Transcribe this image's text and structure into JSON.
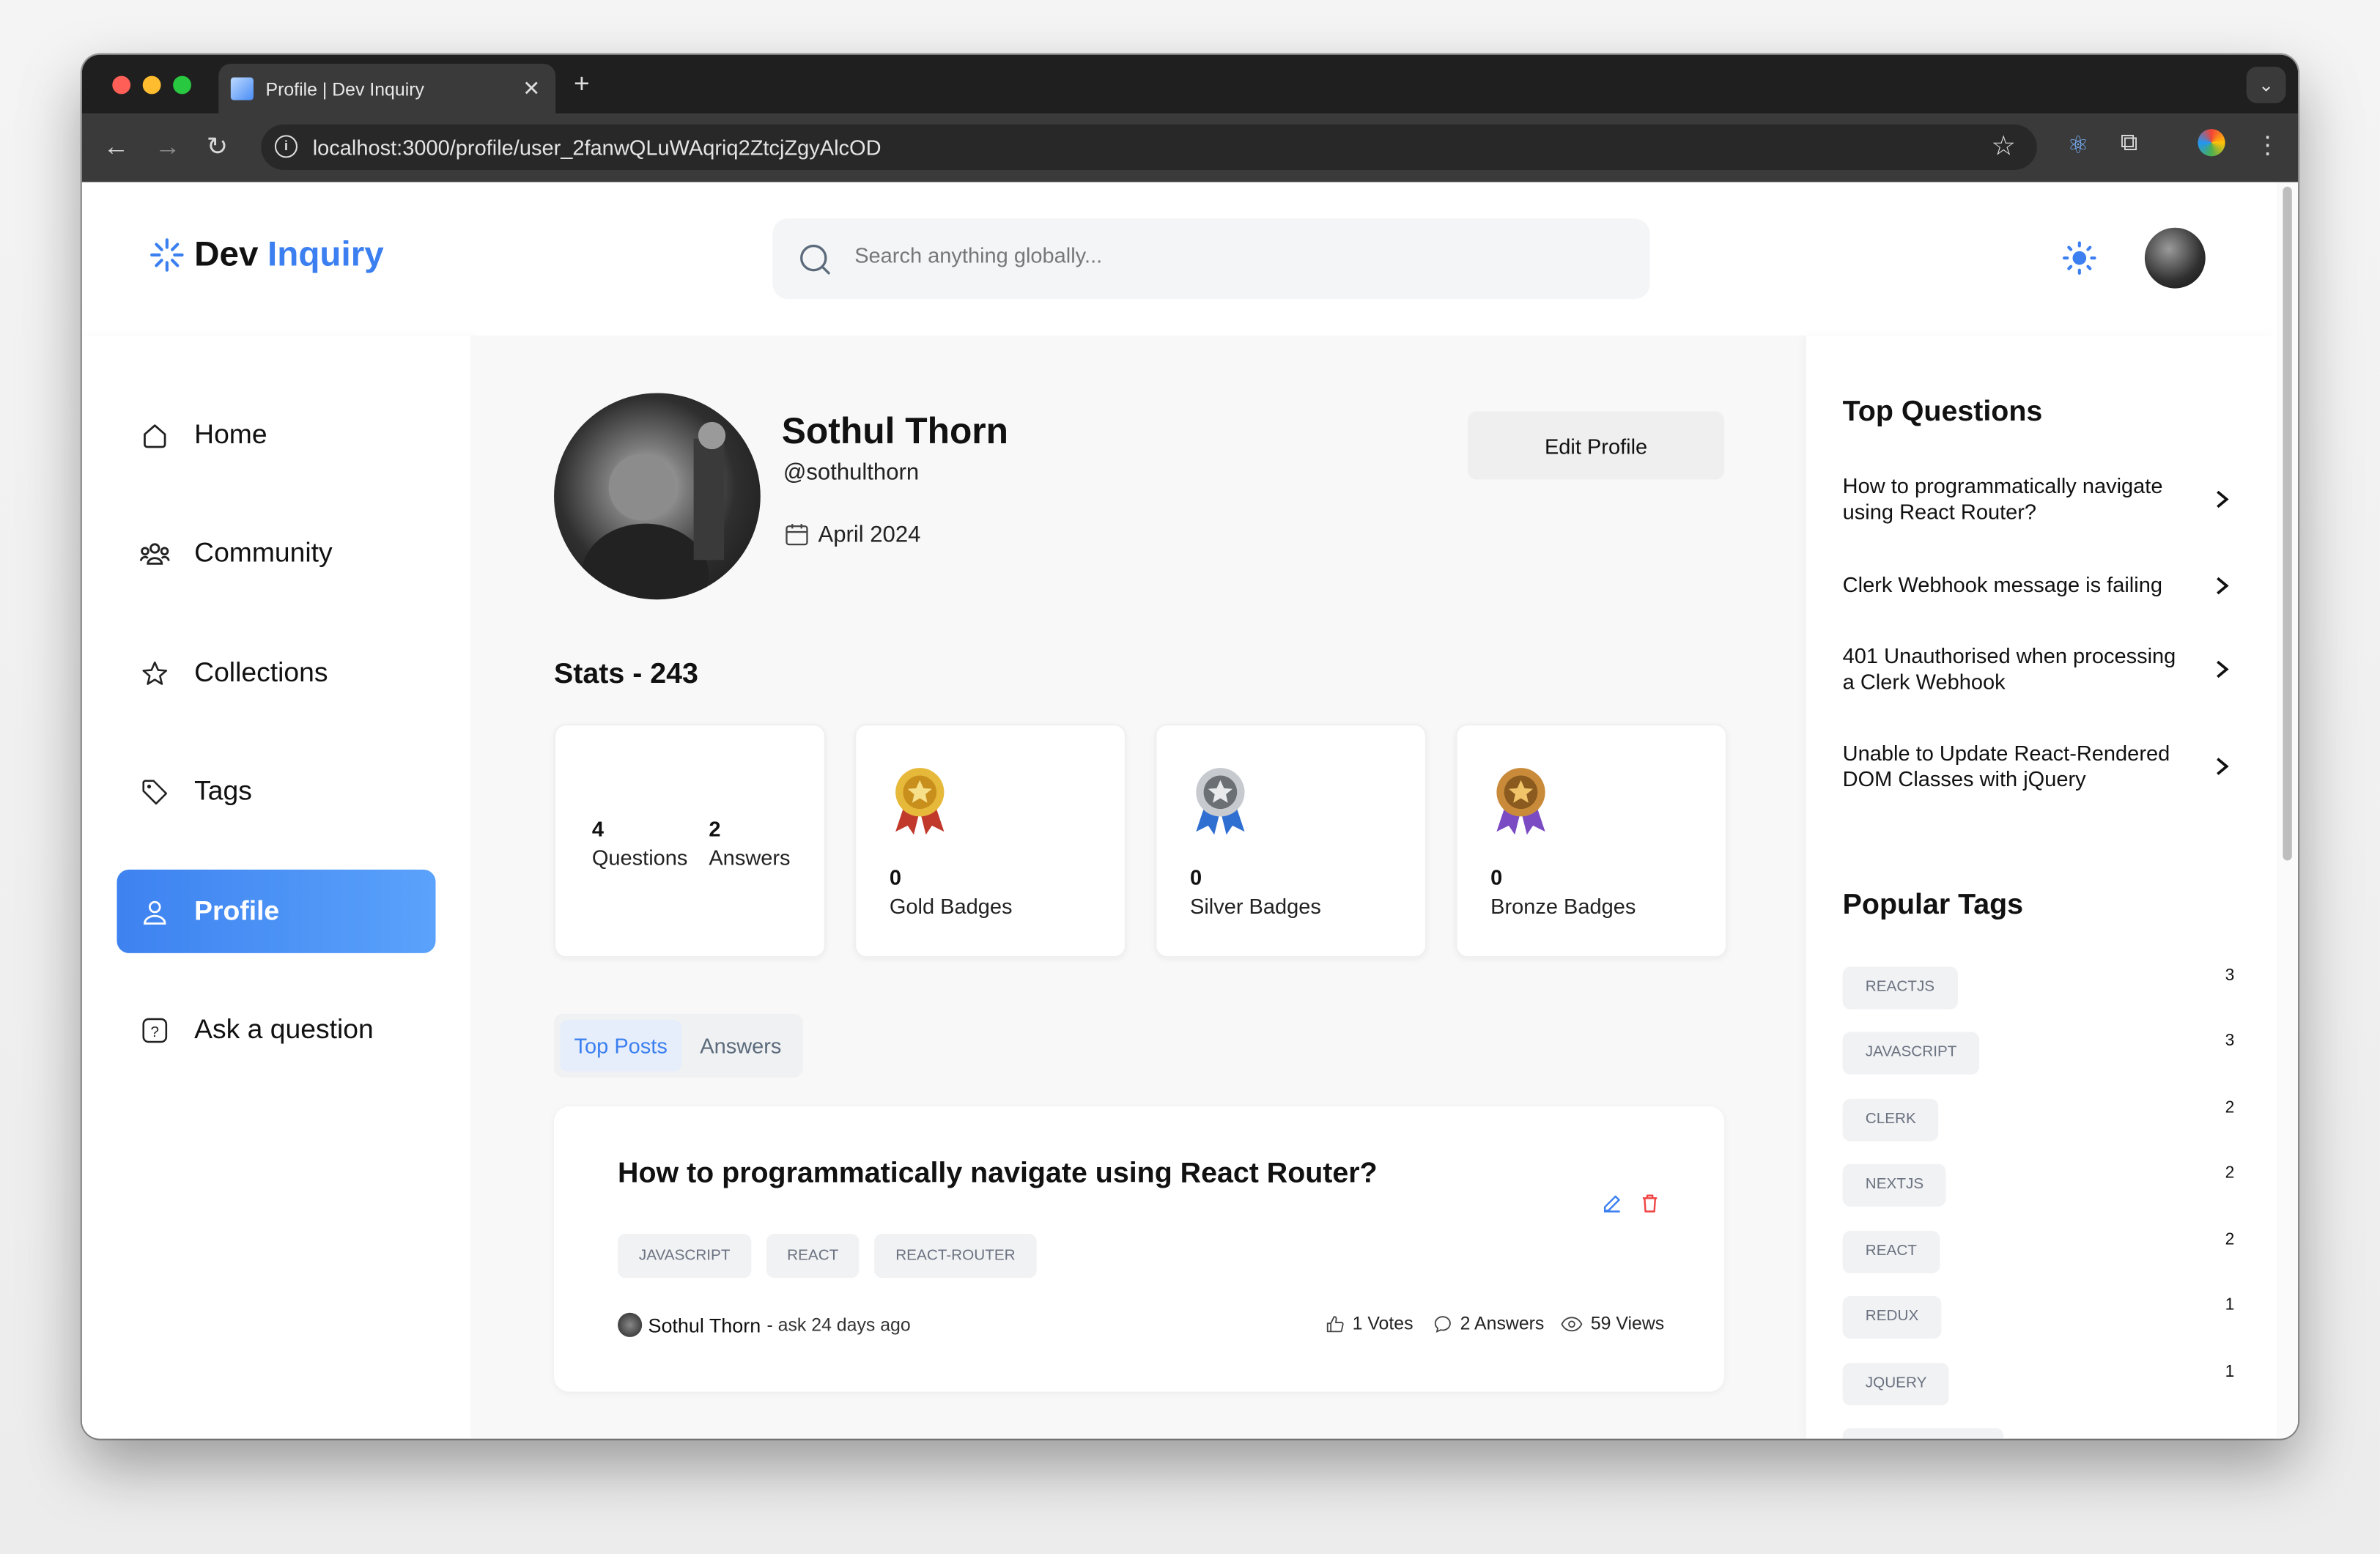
{
  "browser": {
    "tab_title": "Profile | Dev Inquiry",
    "url": "localhost:3000/profile/user_2fanwQLuWAqriq2ZtcjZgyAlcOD"
  },
  "header": {
    "logo_dev": "Dev",
    "logo_inquiry": "Inquiry",
    "search_placeholder": "Search anything globally..."
  },
  "sidebar": {
    "items": [
      {
        "label": "Home",
        "icon": "home-icon"
      },
      {
        "label": "Community",
        "icon": "users-icon"
      },
      {
        "label": "Collections",
        "icon": "star-icon"
      },
      {
        "label": "Tags",
        "icon": "tag-icon"
      },
      {
        "label": "Profile",
        "icon": "user-icon",
        "active": true
      },
      {
        "label": "Ask a question",
        "icon": "question-icon"
      }
    ]
  },
  "profile": {
    "name": "Sothul Thorn",
    "handle": "@sothulthorn",
    "joined": "April 2024",
    "edit_label": "Edit Profile"
  },
  "stats": {
    "title": "Stats - 243",
    "questions_count": "4",
    "questions_label": "Questions",
    "answers_count": "2",
    "answers_label": "Answers",
    "gold_count": "0",
    "gold_label": "Gold Badges",
    "silver_count": "0",
    "silver_label": "Silver Badges",
    "bronze_count": "0",
    "bronze_label": "Bronze Badges"
  },
  "tabs": {
    "top_posts": "Top Posts",
    "answers": "Answers"
  },
  "post": {
    "title": "How to programmatically navigate using React Router?",
    "tags": [
      "JAVASCRIPT",
      "REACT",
      "REACT-ROUTER"
    ],
    "author": "Sothul Thorn",
    "asked": "- ask 24 days ago",
    "votes": "1 Votes",
    "answers": "2 Answers",
    "views": "59 Views"
  },
  "right": {
    "top_questions_title": "Top Questions",
    "top_questions": [
      "How to programmatically navigate using React Router?",
      "Clerk Webhook message is failing",
      "401 Unauthorised when processing a Clerk Webhook",
      "Unable to Update React-Rendered DOM Classes with jQuery"
    ],
    "popular_tags_title": "Popular Tags",
    "popular_tags": [
      {
        "name": "REACTJS",
        "count": "3"
      },
      {
        "name": "JAVASCRIPT",
        "count": "3"
      },
      {
        "name": "CLERK",
        "count": "2"
      },
      {
        "name": "NEXTJS",
        "count": "2"
      },
      {
        "name": "REACT",
        "count": "2"
      },
      {
        "name": "REDUX",
        "count": "1"
      },
      {
        "name": "JQUERY",
        "count": "1"
      }
    ]
  },
  "colors": {
    "accent": "#3b7ff0",
    "gold": "#d4a72c",
    "silver": "#9aa0a6",
    "bronze": "#b07a2a",
    "delete": "#ef4444"
  }
}
